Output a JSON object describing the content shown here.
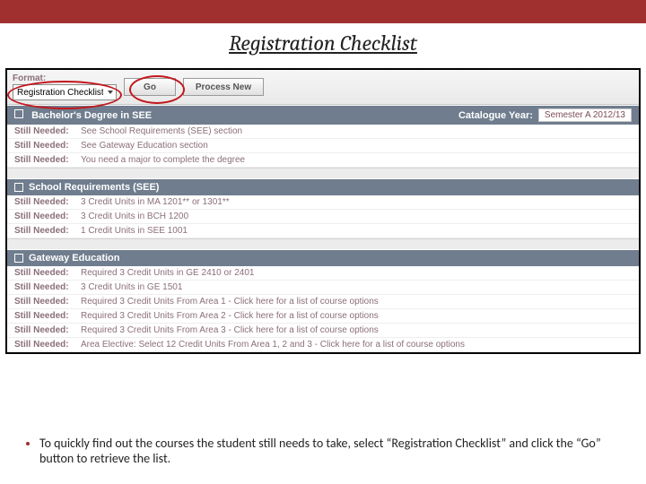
{
  "slide": {
    "title": "Registration Checklist",
    "bullet": "To quickly find out the courses the student still needs to take, select “Registration Checklist” and click the “Go” button to retrieve the list."
  },
  "toolbar": {
    "format_label": "Format:",
    "format_value": "Registration Checklist",
    "go_label": "Go",
    "process_new_label": "Process New"
  },
  "sections": {
    "program": {
      "title": "Bachelor's Degree in SEE",
      "catalogue_label": "Catalogue Year:",
      "catalogue_value": "Semester A 2012/13",
      "items": [
        "See School Requirements (SEE) section",
        "See Gateway Education section",
        "You need a major to complete the degree"
      ]
    },
    "school": {
      "title": "School Requirements (SEE)",
      "items": [
        "3 Credit Units in MA 1201** or 1301**",
        "3 Credit Units in BCH 1200",
        "1 Credit Units in SEE 1001"
      ]
    },
    "gateway": {
      "title": "Gateway Education",
      "items": [
        "Required 3 Credit Units in GE 2410 or 2401",
        "3 Credit Units in GE 1501",
        "Required 3 Credit Units From Area 1 - Click here for a list of course options",
        "Required 3 Credit Units From Area 2 - Click here for a list of course options",
        "Required 3 Credit Units From Area 3 - Click here for a list of course options",
        "Area Elective: Select 12 Credit Units From Area 1, 2 and 3 - Click here for a list of course options"
      ]
    }
  },
  "labels": {
    "still_needed": "Still Needed:"
  }
}
